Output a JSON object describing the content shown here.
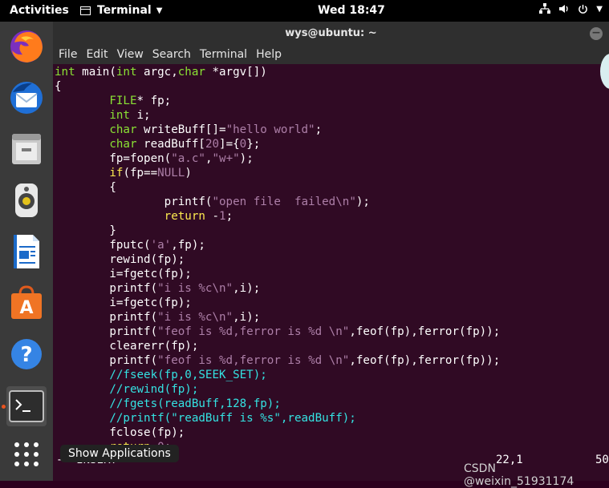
{
  "topbar": {
    "activities": "Activities",
    "app_name": "Terminal",
    "clock": "Wed 18:47"
  },
  "window": {
    "title": "wys@ubuntu: ~",
    "menu": [
      "File",
      "Edit",
      "View",
      "Search",
      "Terminal",
      "Help"
    ]
  },
  "dock": {
    "items": [
      "firefox-icon",
      "thunderbird-icon",
      "files-icon",
      "rhythmbox-icon",
      "writer-icon",
      "software-icon",
      "help-icon",
      "terminal-icon",
      "apps-grid-icon"
    ],
    "tooltip": "Show Applications"
  },
  "editor": {
    "status_mode": "-- INSERT --",
    "cursor_pos": "22,1",
    "scroll_pct": "50"
  },
  "watermark": "CSDN @weixin_51931174",
  "colors": {
    "terminal_bg": "#300a24",
    "keyword": "#8ae234",
    "string": "#ad7fa8",
    "comment": "#34e2e2",
    "accent": "#e95420"
  }
}
